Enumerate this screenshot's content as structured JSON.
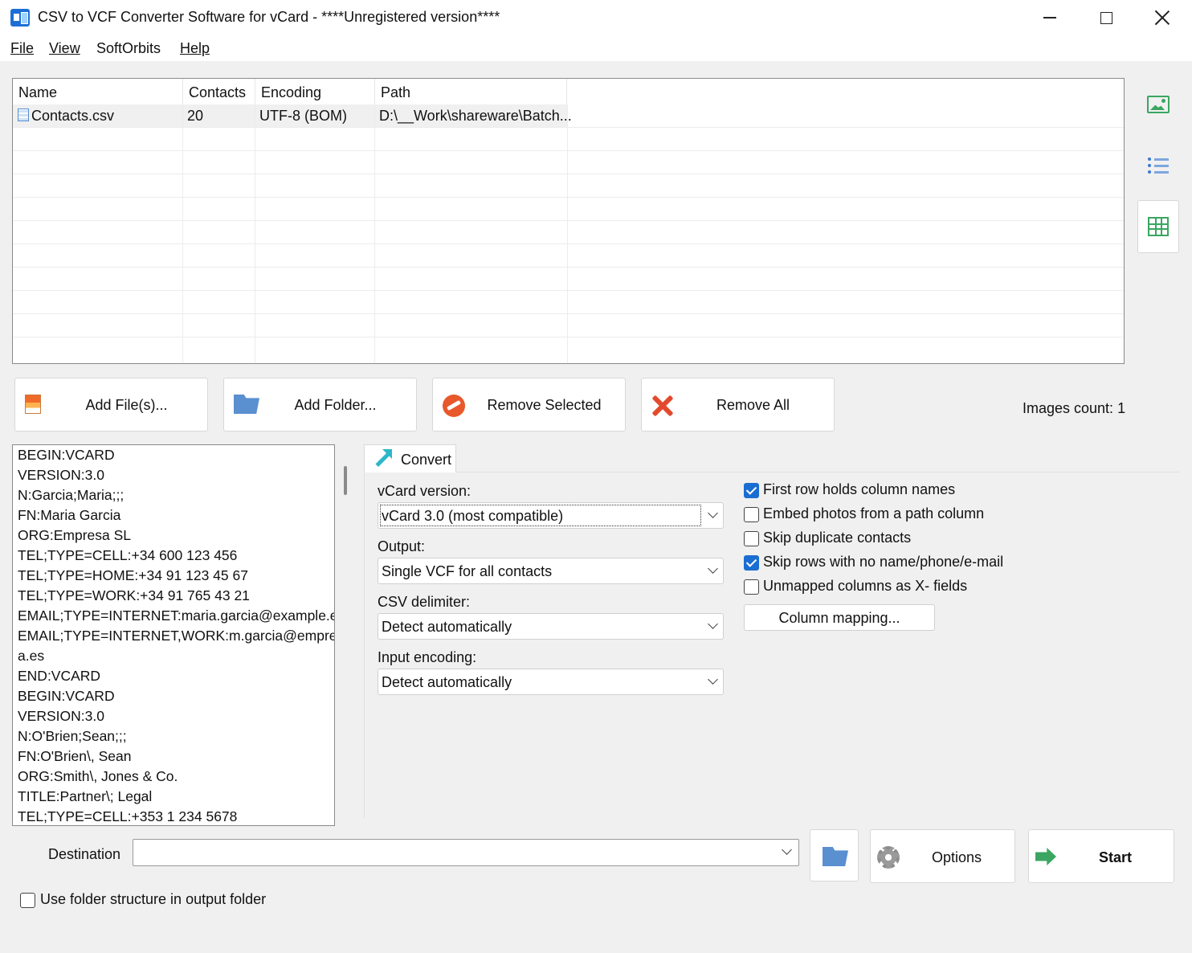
{
  "window": {
    "title": "CSV to VCF Converter Software for vCard - ****Unregistered version****"
  },
  "menu": {
    "file": "File",
    "view": "View",
    "softorbits": "SoftOrbits",
    "help": "Help"
  },
  "file_list": {
    "columns": [
      "Name",
      "Contacts",
      "Encoding",
      "Path"
    ],
    "rows": [
      {
        "name": "Contacts.csv",
        "contacts": "20",
        "encoding": "UTF-8 (BOM)",
        "path": "D:\\__Work\\shareware\\Batch..."
      }
    ]
  },
  "sidebar": {
    "icons": [
      "picture-icon",
      "list-view-icon",
      "table-view-icon"
    ]
  },
  "actions": {
    "add_files": "Add File(s)...",
    "add_folder": "Add Folder...",
    "remove_selected": "Remove Selected",
    "remove_all": "Remove All",
    "images_count": "Images count: 1"
  },
  "preview": {
    "lines": [
      "BEGIN:VCARD",
      "VERSION:3.0",
      "N:Garcia;Maria;;;",
      "FN:Maria Garcia",
      "ORG:Empresa SL",
      "TEL;TYPE=CELL:+34 600 123 456",
      "TEL;TYPE=HOME:+34 91 123 45 67",
      "TEL;TYPE=WORK:+34 91 765 43 21",
      "EMAIL;TYPE=INTERNET:maria.garcia@example.es",
      "EMAIL;TYPE=INTERNET,WORK:m.garcia@empres",
      "a.es",
      "END:VCARD",
      "BEGIN:VCARD",
      "VERSION:3.0",
      "N:O'Brien;Sean;;;",
      "FN:O'Brien\\, Sean",
      "ORG:Smith\\, Jones & Co.",
      "TITLE:Partner\\; Legal",
      "TEL;TYPE=CELL:+353 1 234 5678"
    ]
  },
  "convert_tab": {
    "label": "Convert",
    "vcard_version_label": "vCard version:",
    "vcard_version_value": "vCard 3.0 (most compatible)",
    "output_label": "Output:",
    "output_value": "Single VCF for all contacts",
    "delimiter_label": "CSV delimiter:",
    "delimiter_value": "Detect automatically",
    "encoding_label": "Input encoding:",
    "encoding_value": "Detect automatically",
    "checkboxes": [
      {
        "label": "First row holds column names",
        "checked": true
      },
      {
        "label": "Embed photos from a path column",
        "checked": false
      },
      {
        "label": "Skip duplicate contacts",
        "checked": false
      },
      {
        "label": "Skip rows with no name/phone/e-mail",
        "checked": true
      },
      {
        "label": "Unmapped columns as X- fields",
        "checked": false
      }
    ],
    "column_mapping": "Column mapping..."
  },
  "bottom": {
    "destination_label": "Destination",
    "destination_value": "",
    "options": "Options",
    "start": "Start",
    "use_folder_structure": "Use folder structure in output folder",
    "use_folder_structure_checked": false
  },
  "colors": {
    "accent": "#1a6dd1",
    "green_icon": "#3aa661",
    "teal_icon": "#2db6c9",
    "danger_icon": "#e34a2d"
  }
}
